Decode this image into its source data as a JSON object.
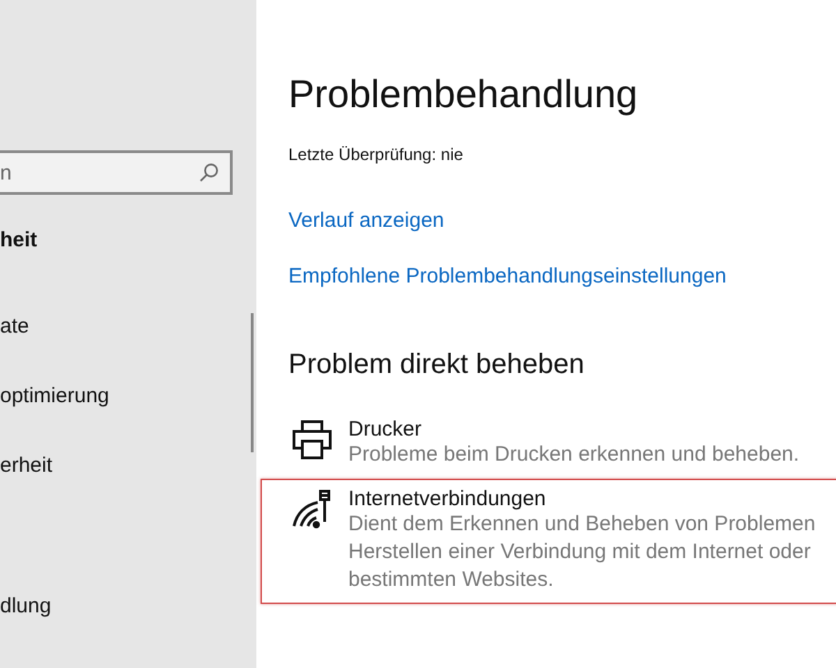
{
  "sidebar": {
    "search": {
      "placeholder": "n"
    },
    "heading": "heit",
    "items": [
      {
        "label": "ate"
      },
      {
        "label": "optimierung"
      },
      {
        "label": "erheit"
      },
      {
        "label": "dlung"
      }
    ]
  },
  "main": {
    "title": "Problembehandlung",
    "last_check": "Letzte Überprüfung: nie",
    "links": [
      "Verlauf anzeigen",
      "Empfohlene Problembehandlungseinstellungen"
    ],
    "section_title": "Problem direkt beheben",
    "troubleshooters": [
      {
        "kind": "printer",
        "title": "Drucker",
        "description": [
          "Probleme beim Drucken erkennen und beheben."
        ],
        "selected": false
      },
      {
        "kind": "network",
        "title": "Internetverbindungen",
        "description": [
          "Dient dem Erkennen und Beheben von Problemen",
          "Herstellen einer Verbindung mit dem Internet oder",
          "bestimmten Websites."
        ],
        "selected": true
      }
    ]
  }
}
